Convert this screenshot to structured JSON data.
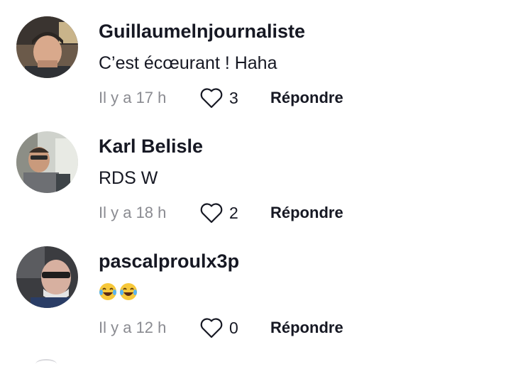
{
  "comments": [
    {
      "username": "Guillaumelnjournaliste",
      "text": "C’est écœurant ! Haha",
      "time": "Il y a 17 h",
      "likes": "3",
      "reply_label": "Répondre",
      "avatar_icon": "man-headphones-avatar"
    },
    {
      "username": "Karl Belisle",
      "text": "RDS W",
      "time": "Il y a 18 h",
      "likes": "2",
      "reply_label": "Répondre",
      "avatar_icon": "man-in-car-avatar"
    },
    {
      "username": "pascalproulx3p",
      "text": "😂😂",
      "time": "Il y a 12 h",
      "likes": "0",
      "reply_label": "Répondre",
      "avatar_icon": "man-glasses-avatar"
    }
  ],
  "colors": {
    "text": "#161823",
    "muted": "#8a8b91",
    "background": "#ffffff"
  }
}
